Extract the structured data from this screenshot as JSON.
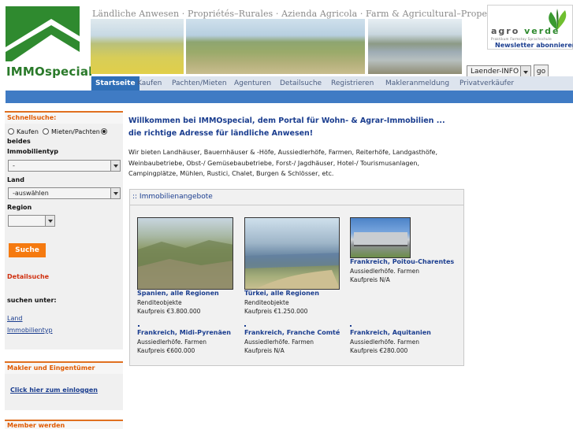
{
  "header": {
    "logo_text": "IMMOspecial",
    "tagline": "Ländliche Anwesen · Propriétés–Rurales · Azienda Agricola · Farm & Agricultural–Properties",
    "agroverde": {
      "word_a": "agro",
      "word_b": "verde",
      "sub": "Praktikum   Farmstay   Sprachschule",
      "newsletter": "Newsletter abonnieren!"
    },
    "country_select": "Laender-INFO",
    "go_label": "go"
  },
  "nav": {
    "items": [
      "Startseite",
      "Kaufen",
      "Pachten/Mieten",
      "Agenturen",
      "Detailsuche",
      "Registrieren",
      "Makleranmeldung",
      "Privatverkäufer"
    ]
  },
  "sidebar": {
    "quick_title": "Schnellsuche:",
    "radio_buy": "Kaufen",
    "radio_rent": "Mieten/Pachten",
    "radio_both": "beides",
    "type_label": "Immobilientyp",
    "type_value": "-",
    "country_label": "Land",
    "country_value": "-auswählen",
    "region_label": "Region",
    "region_value": "",
    "search_button": "Suche",
    "detail_link": "Detailsuche",
    "search_under": "suchen unter:",
    "link_land": "Land",
    "link_type": "Immobilientyp",
    "broker_title": "Makler und Eingentümer",
    "broker_link": "Click hier zum einloggen",
    "member_title": "Member werden"
  },
  "main": {
    "welcome": "Willkommen bei IMMOspecial, dem Portal für Wohn- & Agrar-Immobilien ... die richtige Adresse für ländliche Anwesen!",
    "intro": "Wir bieten Landhäuser, Bauernhäuser & -Höfe, Aussiedlerhöfe, Farmen, Reiterhöfe, Landgasthöfe, Weinbaubetriebe, Obst-/ Gemüsebaubetriebe, Forst-/ Jagdhäuser, Hotel-/ Tourismusanlagen, Campingplätze, Mühlen, Rustici, Chalet, Burgen & Schlösser, etc.",
    "offers_title": ":: Immobilienangebote",
    "offers": [
      {
        "title": "Spanien, alle Regionen",
        "type": "Renditeobjekte",
        "price": "Kaufpreis €3.800.000"
      },
      {
        "title": "Türkei, alle Regionen",
        "type": "Renditeobjekte",
        "price": "Kaufpreis €1.250.000"
      },
      {
        "title": "Frankreich, Poitou-Charentes",
        "type": "Aussiedlerhöfe. Farmen",
        "price": "Kaufpreis N/A"
      },
      {
        "title": "Frankreich, Midi-Pyrenäen",
        "type": "Aussiedlerhöfe. Farmen",
        "price": "Kaufpreis €600.000"
      },
      {
        "title": "Frankreich, Franche Comté",
        "type": "Aussiedlerhöfe. Farmen",
        "price": "Kaufpreis N/A"
      },
      {
        "title": "Frankreich, Aquitanien",
        "type": "Aussiedlerhöfe. Farmen",
        "price": "Kaufpreis €280.000"
      }
    ]
  },
  "colors": {
    "brand_green": "#2f8a2f",
    "nav_blue": "#2f6fb7",
    "accent_orange": "#f57a10",
    "link_blue": "#1a3d8f"
  }
}
